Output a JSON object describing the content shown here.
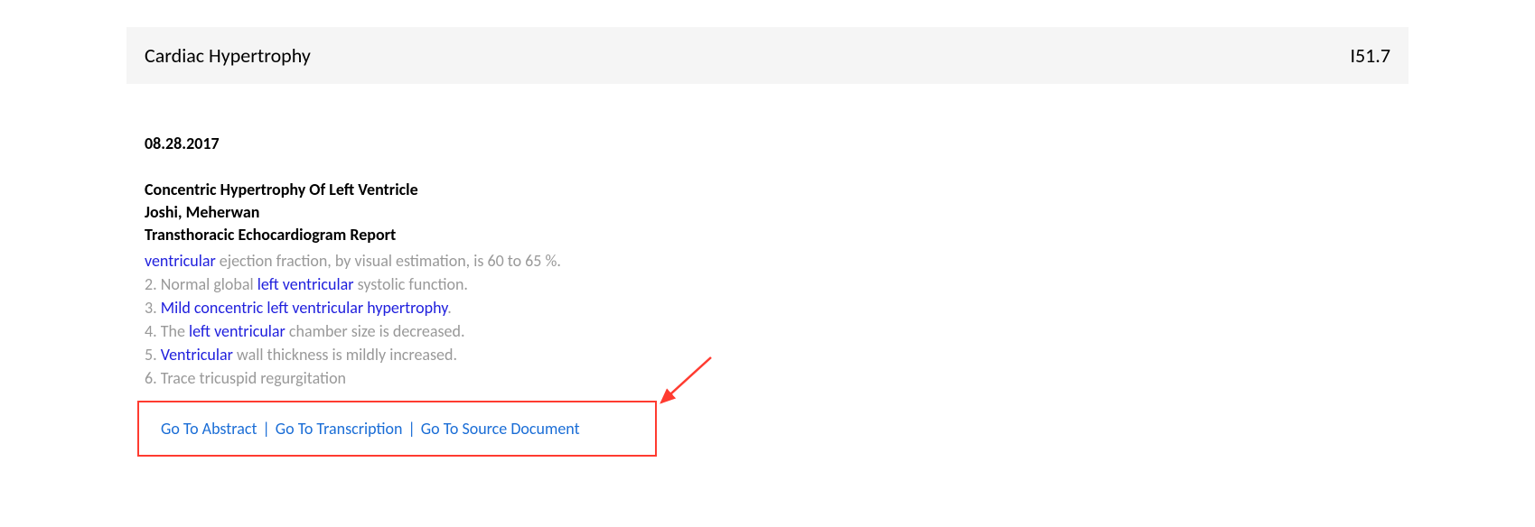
{
  "header": {
    "title": "Cardiac Hypertrophy",
    "code": "I51.7"
  },
  "entry": {
    "date": "08.28.2017",
    "diagnosis": "Concentric Hypertrophy Of Left Ventricle",
    "provider": "Joshi, Meherwan",
    "report_type": "Transthoracic Echocardiogram Report",
    "findings": {
      "line1_hl": "ventricular",
      "line1_rest": " ejection fraction, by visual estimation, is 60 to 65 %.",
      "line2_pre": "2. Normal global ",
      "line2_hl": "left ventricular",
      "line2_post": " systolic function.",
      "line3_pre": "3. ",
      "line3_hl": "Mild concentric left ventricular hypertrophy",
      "line3_post": ".",
      "line4_pre": "4. The ",
      "line4_hl": "left ventricular",
      "line4_post": " chamber size is decreased.",
      "line5_pre": "5. ",
      "line5_hl": "Ventricular",
      "line5_post": " wall thickness is mildly increased.",
      "line6": "6. Trace tricuspid regurgitation"
    }
  },
  "links": {
    "abstract": "Go To Abstract",
    "transcription": "Go To Transcription",
    "source": "Go To Source Document",
    "separator": "|"
  }
}
